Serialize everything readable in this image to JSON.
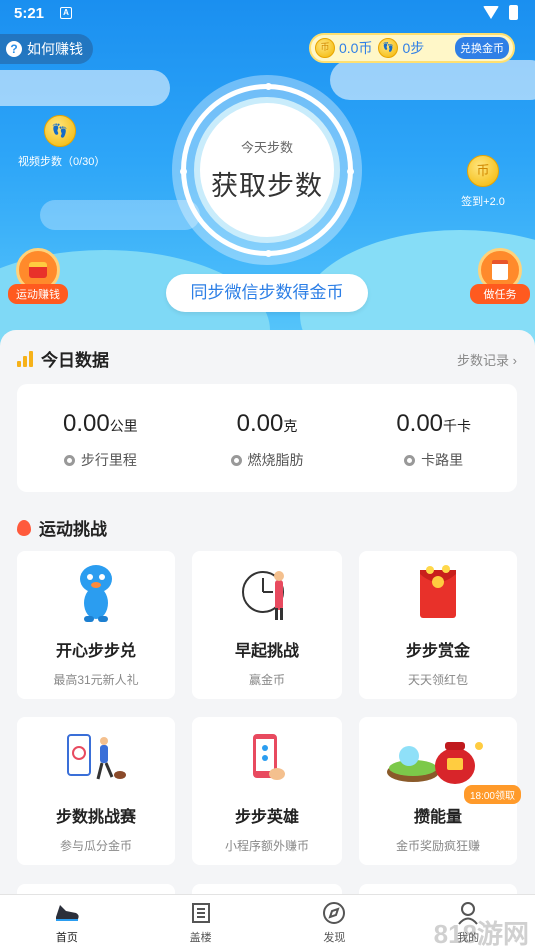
{
  "status_bar": {
    "time": "5:21",
    "notif_icon": "A"
  },
  "header": {
    "how_to_earn": "如何赚钱",
    "coins_value": "0.0币",
    "steps_value": "0步",
    "exchange_label": "兑换金币",
    "coin_glyph": "币",
    "today_steps_label": "今天步数",
    "get_steps_label": "获取步数",
    "video_steps_label": "视频步数（0/30）",
    "checkin_label": "签到+2.0",
    "sport_earn_label": "运动赚钱",
    "tasks_label": "做任务",
    "sync_label": "同步微信步数得金币"
  },
  "today_data": {
    "title": "今日数据",
    "record_link": "步数记录 ›",
    "stats": [
      {
        "value": "0.00",
        "unit": "公里",
        "desc": "步行里程"
      },
      {
        "value": "0.00",
        "unit": "克",
        "desc": "燃烧脂肪"
      },
      {
        "value": "0.00",
        "unit": "千卡",
        "desc": "卡路里"
      }
    ]
  },
  "challenges": {
    "title": "运动挑战",
    "cards": [
      {
        "title": "开心步步兑",
        "subtitle": "最高31元新人礼"
      },
      {
        "title": "早起挑战",
        "subtitle": "赢金币"
      },
      {
        "title": "步步赏金",
        "subtitle": "天天领红包"
      },
      {
        "title": "步数挑战赛",
        "subtitle": "参与瓜分金币"
      },
      {
        "title": "步步英雄",
        "subtitle": "小程序额外赚币"
      },
      {
        "title": "攒能量",
        "subtitle": "金币奖励疯狂赚"
      }
    ],
    "energy_tag": "18:00领取"
  },
  "tabbar": {
    "tabs": [
      "首页",
      "盖楼",
      "发现",
      "我的"
    ]
  },
  "watermark": "818游网",
  "colors": {
    "primary": "#2d7fe6",
    "accent": "#ff8a2b",
    "coin": "#f3b500"
  }
}
